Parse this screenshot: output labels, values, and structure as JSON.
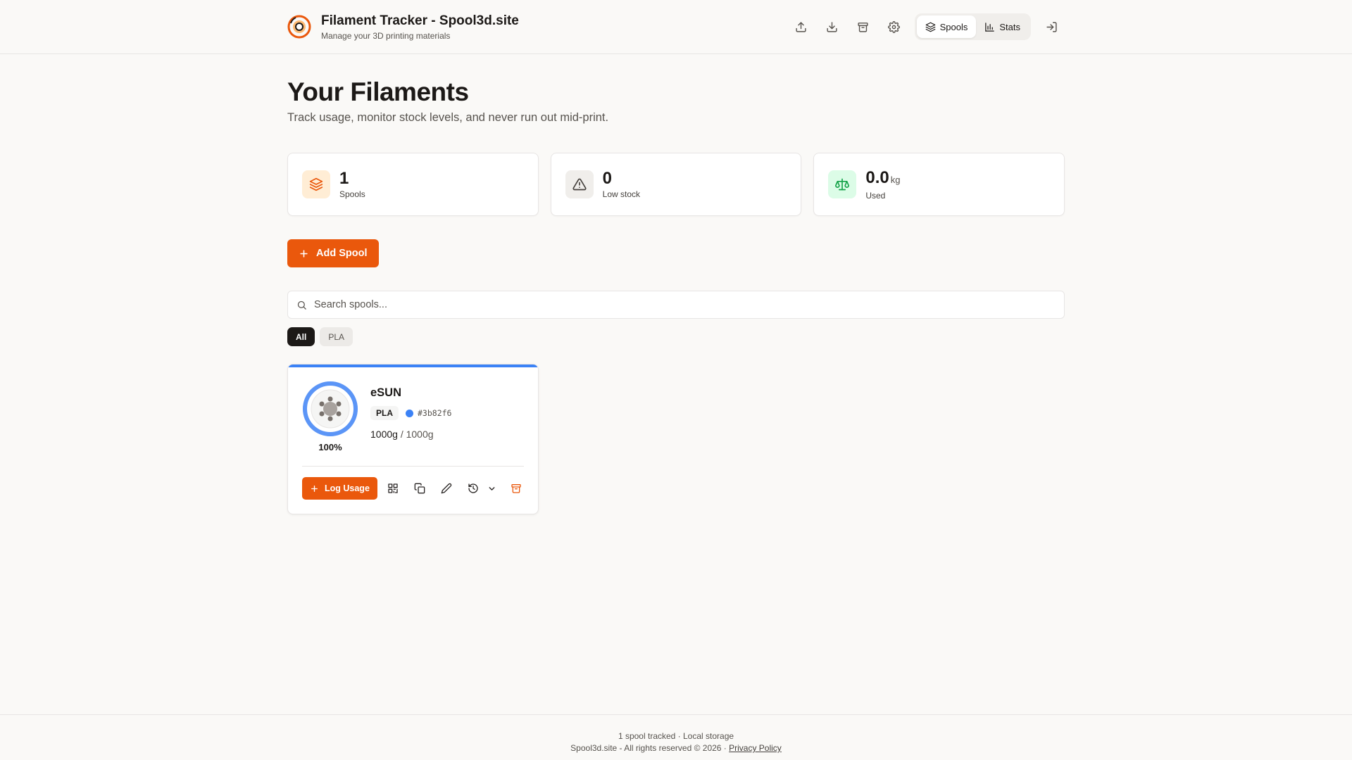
{
  "app": {
    "title": "Filament Tracker - Spool3d.site",
    "subtitle": "Manage your 3D printing materials"
  },
  "header": {
    "actions": [
      {
        "icon": "upload-icon"
      },
      {
        "icon": "download-icon"
      },
      {
        "icon": "archive-icon"
      },
      {
        "icon": "gear-icon"
      }
    ],
    "nav": [
      {
        "label": "Spools",
        "icon": "layers-icon",
        "active": true
      },
      {
        "label": "Stats",
        "icon": "bar-chart-icon",
        "active": false
      }
    ],
    "login_icon": "log-in-icon"
  },
  "page": {
    "title": "Your Filaments",
    "subtitle": "Track usage, monitor stock levels, and never run out mid-print."
  },
  "stats": [
    {
      "value": "1",
      "unit": "",
      "label": "Spools",
      "icon": "layers-icon",
      "color": "#ea580c",
      "bg": "#ffedd5"
    },
    {
      "value": "0",
      "unit": "",
      "label": "Low stock",
      "icon": "alert-triangle-icon",
      "color": "#57534e",
      "bg": "#f5f5f4"
    },
    {
      "value": "0.0",
      "unit": "kg",
      "label": "Used",
      "icon": "scale-icon",
      "color": "#16a34a",
      "bg": "#dcfce7"
    }
  ],
  "add_button": {
    "label": "Add Spool"
  },
  "search": {
    "placeholder": "Search spools...",
    "value": ""
  },
  "filters": [
    {
      "label": "All",
      "active": true
    },
    {
      "label": "PLA",
      "active": false
    }
  ],
  "spools": [
    {
      "brand": "eSUN",
      "type": "PLA",
      "color_hex": "#3b82f6",
      "remaining": "1000g",
      "total": "/ 1000g",
      "percent_label": "100%",
      "percent": 100,
      "log_label": "Log Usage"
    }
  ],
  "footer": {
    "line1": "1 spool tracked · Local storage",
    "line2": "Spool3d.site - All rights reserved © 2026 · ",
    "privacy": "Privacy Policy"
  },
  "colors": {
    "accent": "#ea580c",
    "spool_blue": "#3b82f6"
  }
}
